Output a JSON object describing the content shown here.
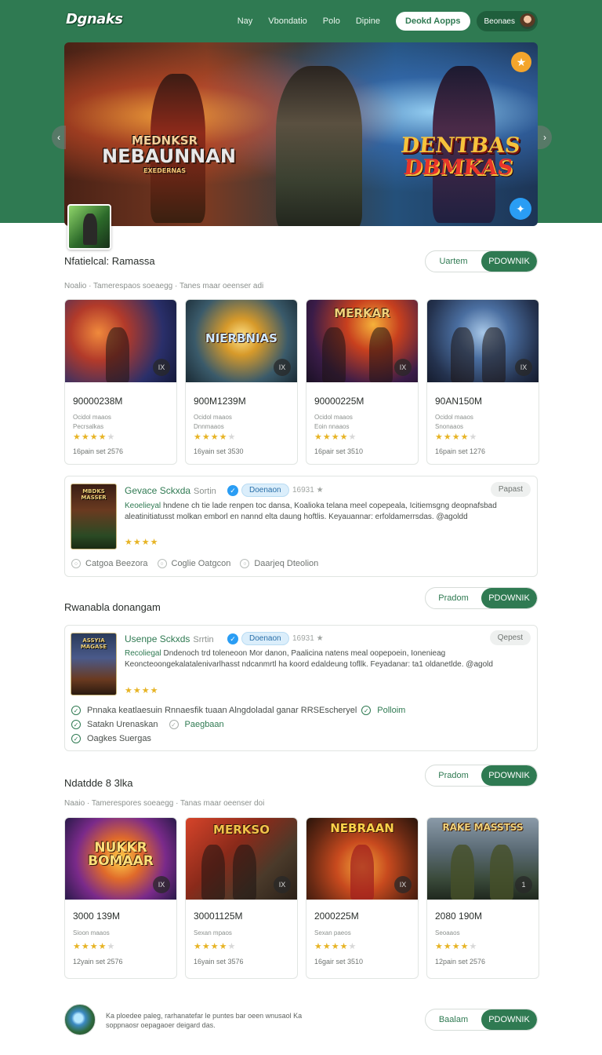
{
  "header": {
    "logo": "Dgnaks",
    "nav": [
      "Nay",
      "Vbondatio",
      "Polo",
      "Dipine"
    ],
    "cta": "Deokd Aopps",
    "account": "Beonaes"
  },
  "hero": {
    "title_left": [
      "MEDNKSR",
      "NEBAUNNAN",
      "EXEDERNAS"
    ],
    "title_right": [
      "DENTBAS",
      "DBMKAS"
    ],
    "prev_icon": "‹",
    "next_icon": "›"
  },
  "section1": {
    "title": "Nfatielcal: Ramassa",
    "subline": "Noalio  ·  Tamerespaos soeaegg  ·  Tanes maar oeenser adi",
    "toggle": [
      "Uartem",
      "PDOWNIK"
    ],
    "cards": [
      {
        "art_text": "",
        "corner": "IX",
        "size": "90000238M",
        "meta1": "Ocidol maaos",
        "meta2": "Pecrsalkas",
        "stars": 4,
        "foot": "16pain set  2576"
      },
      {
        "art_text": "NIERBNIAS",
        "corner": "IX",
        "size": "900M1239M",
        "meta1": "Ocidol maaos",
        "meta2": "Dnnmaaos",
        "stars": 4,
        "foot": "16yain set  3530"
      },
      {
        "art_text": "MERKAR",
        "corner": "IX",
        "size": "90000225M",
        "meta1": "Ocidol maaos",
        "meta2": "Eoin nnaaos",
        "stars": 4,
        "foot": "16pair set  3510"
      },
      {
        "art_text": "",
        "corner": "IX",
        "size": "90AN150M",
        "meta1": "Ocidol maaos",
        "meta2": "Snonaaos",
        "stars": 4,
        "foot": "16pain set  1276"
      }
    ]
  },
  "panel1": {
    "cover_title": "MBDKS MASSER",
    "name": "Gevace Sckxda",
    "developer": "Sortin",
    "pill": "Doenaon",
    "count": "16931 ★",
    "report": "Papast",
    "desc_lead": "Keoelieyal",
    "desc": "hndene ch tie lade renpen toc dansa, Koalioka telana meel copepeala, Icitiemsgng deopnafsbad aleatinitiatusst molkan emborl en nannd elta daung hoftlis. Keyauannar: erfoldamerrsdas. @agoldd",
    "rating": "★★★★",
    "tags": [
      "Catgoa Beezora",
      "Coglie Oatgcon",
      "Daarjeq Dteolion"
    ]
  },
  "section2": {
    "title": "Rwanabla donangam",
    "toggle": [
      "Pradom",
      "PDOWNIK"
    ]
  },
  "panel2": {
    "cover_title": "ASSYIA MAGASE",
    "name": "Usenpe Sckxds",
    "developer": "Srrtin",
    "pill": "Doenaon",
    "count": "16931 ★",
    "report": "Qepest",
    "desc_lead": "Recoliegal",
    "desc": "Dndenoch trd toleneoon Mor danon, Paalicina natens meal oopepoein, Ionenieag Keoncteoongekalatalenivarlhasst ndcanmrtl ha koord edaldeung tofllk. Feyadanar: ta1 oldanetlde. @agold",
    "rating": "★★★★",
    "checklist": [
      {
        "text": "Pnnaka keatlaesuin Rnnaesfik tuaan Alngdoladal ganar RRSEscheryel",
        "extra": "Polloim"
      },
      {
        "text": "Satakn Urenaskan",
        "extra": "Paegbaan"
      },
      {
        "text": "Oagkes Suergas",
        "extra": ""
      }
    ]
  },
  "section3": {
    "title": "Ndatdde 8 3lka",
    "subline": "Naaio  ·  Tamerespores soeaegg  ·  Tanas maar oeenser doi",
    "toggle": [
      "Pradom",
      "PDOWNIK"
    ],
    "cards": [
      {
        "art_text": "NUKKR BOMAAR",
        "corner": "IX",
        "size": "3000 139M",
        "meta1": "Sioon maaos",
        "stars": 4,
        "foot": "12yain set  2576"
      },
      {
        "art_text": "MERKSO",
        "corner": "IX",
        "size": "30001125M",
        "meta1": "Sexan mpaos",
        "stars": 4,
        "foot": "16yain set  3576"
      },
      {
        "art_text": "NEBRAAN",
        "corner": "IX",
        "size": "2000225M",
        "meta1": "Sexan paeos",
        "stars": 4,
        "foot": "16gair set  3510"
      },
      {
        "art_text": "RAKE MASSTSS",
        "corner": "1",
        "size": "2080 190M",
        "meta1": "Seoaaos",
        "stars": 4,
        "foot": "12pain set  2576"
      }
    ]
  },
  "footer": {
    "text": "Ka ploedee paleg, rarhanatefar le puntes  bar oeen wnusaol Ka soppnaosr oepagaoer deigard das.",
    "toggle": [
      "Baalam",
      "PDOWNIK"
    ]
  },
  "colors": {
    "brand_green": "#2f7a52",
    "star": "#e7b425",
    "verified_blue": "#2a9df4"
  }
}
